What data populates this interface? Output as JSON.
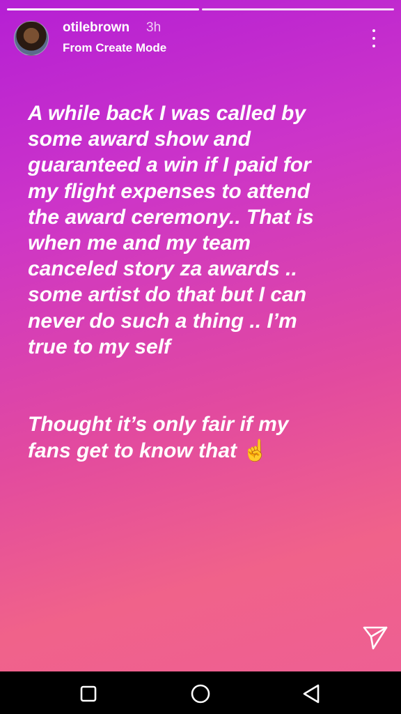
{
  "story": {
    "username": "otilebrown",
    "time": "3h",
    "subtitle": "From Create Mode",
    "segments": [
      {
        "state": "seen"
      },
      {
        "state": "current"
      }
    ],
    "text_lines": [
      "A while back I was called by",
      "some award show and",
      "guaranteed a win if I paid for",
      "my flight expenses to attend",
      "the award ceremony.. That is",
      "when me and my team",
      "canceled story za awards ..",
      "some artist do that  but I can",
      "never do such  a thing .. I’m",
      "true to my self",
      "",
      "",
      "Thought it’s only fair if my"
    ],
    "last_line": "fans get to know that ",
    "emoji": "☝",
    "colors": {
      "gradient_start": "#b51fd4",
      "gradient_end": "#f0628a",
      "text": "#ffffff"
    }
  },
  "icons": {
    "more": "more-vertical-icon",
    "send": "send-icon",
    "recents": "recents-square-icon",
    "home": "home-circle-icon",
    "back": "back-triangle-icon"
  }
}
